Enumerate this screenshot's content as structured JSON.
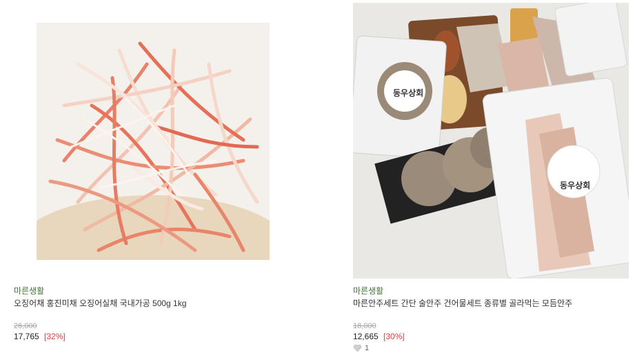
{
  "products": [
    {
      "brand": "마른생활",
      "title": "오징어채 홍진미채 오징어실채 국내가공 500g 1kg",
      "original_price": "26,000",
      "sale_price": "17,765",
      "discount": "[32%]"
    },
    {
      "brand": "마른생활",
      "title": "마른안주세트 간단 술안주 건어물세트 종류별 골라먹는 모듬안주",
      "original_price": "18,000",
      "sale_price": "12,665",
      "discount": "[30%]",
      "wish_count": "1",
      "package_label": "동우상회"
    }
  ],
  "colors": {
    "brand": "#3e7a2e",
    "discount": "#e23b3b",
    "strike": "#a5a5a5"
  },
  "icons": {
    "wish": "heart-icon"
  }
}
